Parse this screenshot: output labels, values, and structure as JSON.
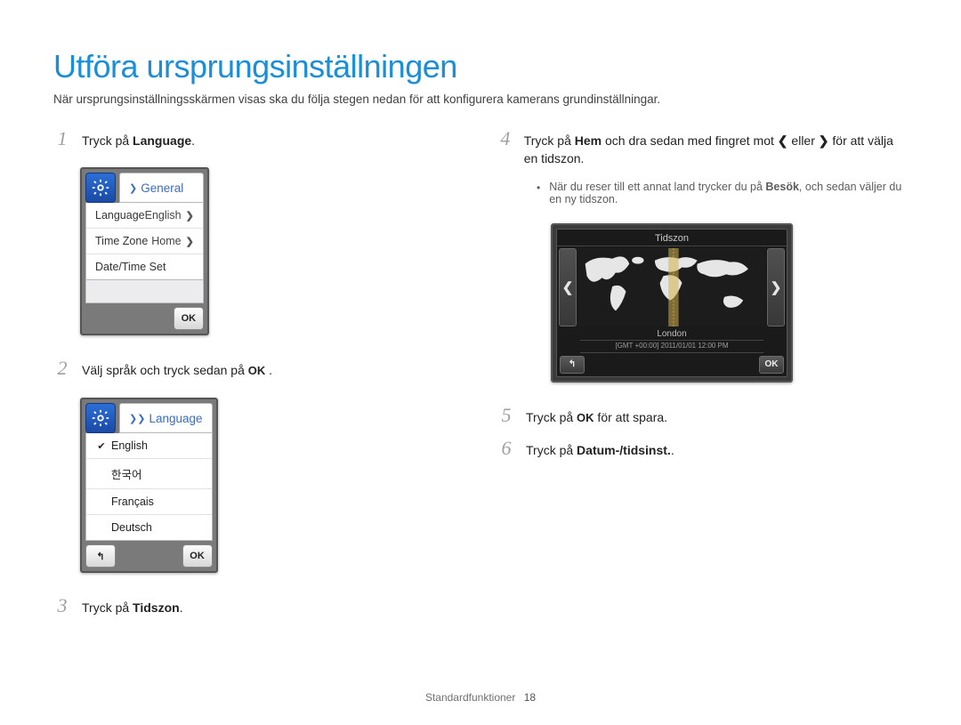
{
  "title": "Utföra ursprungsinställningen",
  "subtitle": "När ursprungsinställningsskärmen visas ska du följa stegen nedan för att konfigurera kamerans grundinställningar.",
  "steps": {
    "s1": {
      "num": "1",
      "pre": "Tryck på ",
      "bold": "Language",
      "post": "."
    },
    "s2": {
      "num": "2",
      "pre": "Välj språk och tryck sedan på ",
      "okLabel": "OK",
      "post": " ."
    },
    "s3": {
      "num": "3",
      "pre": "Tryck på ",
      "bold": "Tidszon",
      "post": "."
    },
    "s4": {
      "num": "4",
      "pre": "Tryck på ",
      "bold1": "Hem",
      "mid1": " och dra sedan med fingret mot ",
      "iconLeft": "❮",
      "mid2": " eller ",
      "iconRight": "❯",
      "post": " för att välja en tidszon."
    },
    "s4_sub": {
      "dot": "•",
      "pre": "När du reser till ett annat land trycker du på ",
      "bold": "Besök",
      "post": ", och sedan väljer du en ny tidszon."
    },
    "s5": {
      "num": "5",
      "pre": "Tryck på ",
      "okLabel": "OK",
      "post": " för att spara."
    },
    "s6": {
      "num": "6",
      "pre": "Tryck på ",
      "bold": "Datum-/tidsinst.",
      "post": "."
    }
  },
  "panel_general": {
    "breadcrumb_icon": "❯",
    "breadcrumb": "General",
    "rows": [
      {
        "label": "Language",
        "value": "English",
        "chev": "❯"
      },
      {
        "label": "Time Zone",
        "value": "Home",
        "chev": "❯"
      },
      {
        "label": "Date/Time Set",
        "value": "",
        "chev": ""
      }
    ],
    "okLabel": "OK"
  },
  "panel_language": {
    "breadcrumb_icon": "❯❯",
    "breadcrumb": "Language",
    "options": [
      "English",
      "한국어",
      "Français",
      "Deutsch"
    ],
    "selected_index": 0,
    "okLabel": "OK",
    "backIcon": "↰"
  },
  "panel_tidszon": {
    "title": "Tidszon",
    "leftArrow": "❮",
    "rightArrow": "❯",
    "city": "London",
    "info": "[GMT +00:00]   2011/01/01   12:00 PM",
    "backIcon": "↰",
    "okLabel": "OK"
  },
  "footer": {
    "label": "Standardfunktioner",
    "page": "18"
  }
}
